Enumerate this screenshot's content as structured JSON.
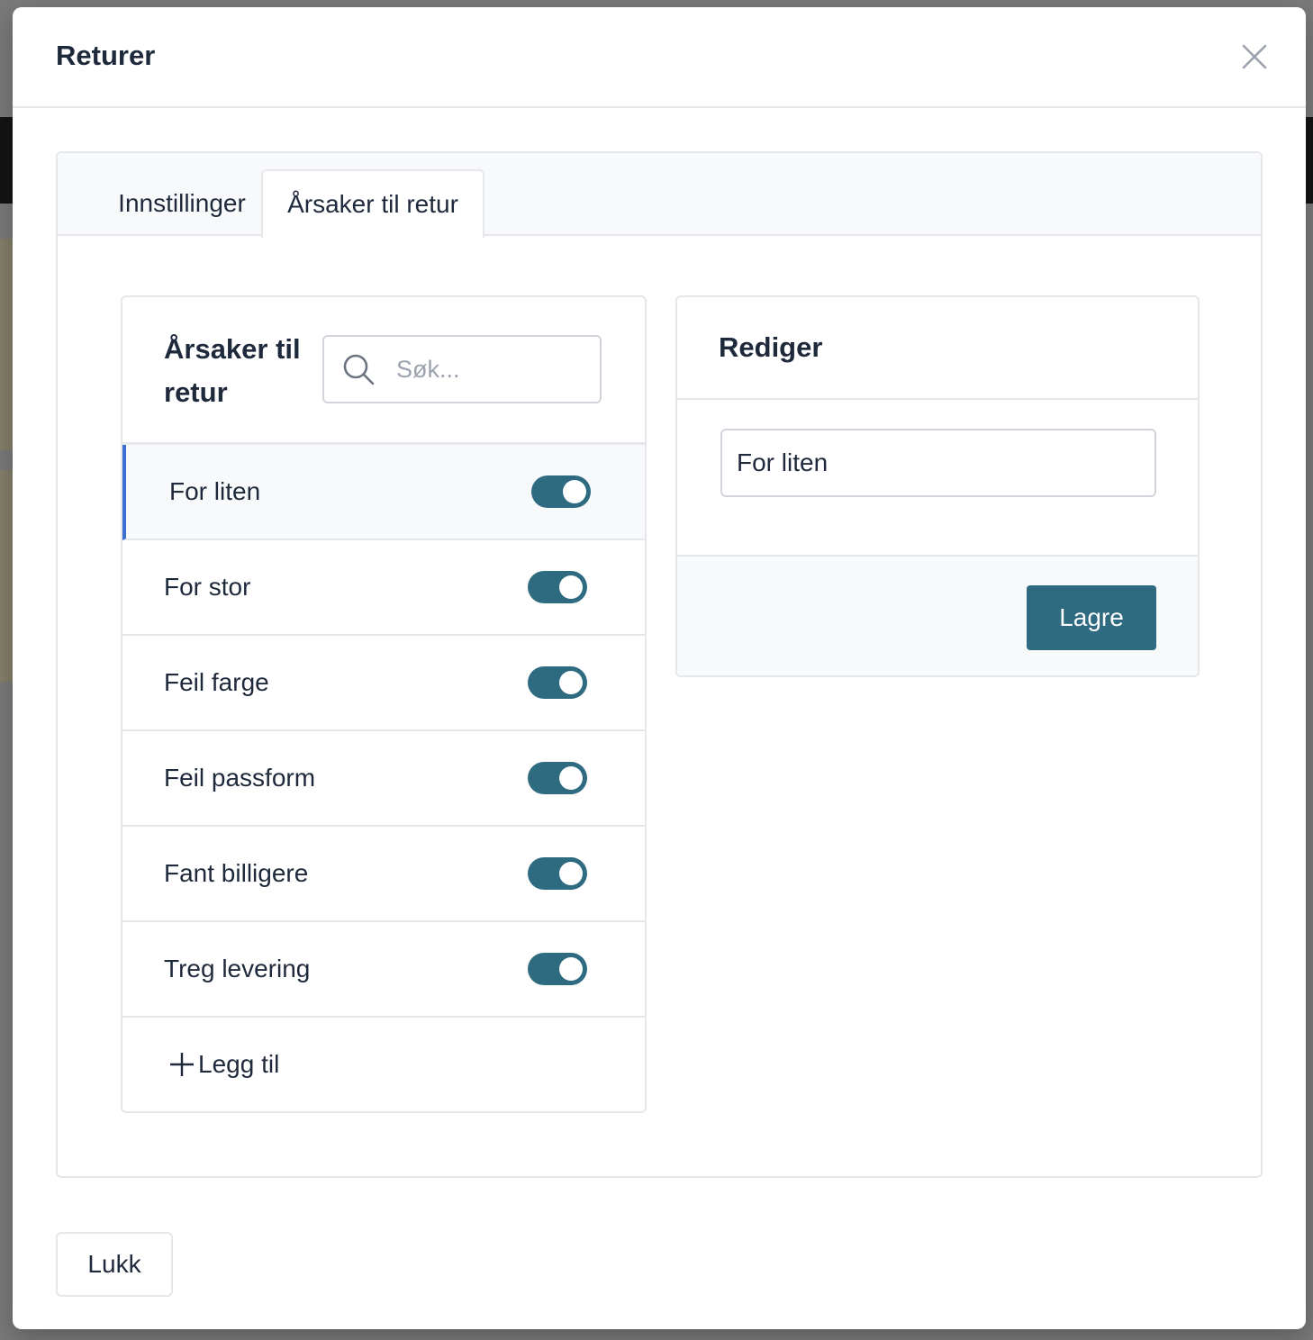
{
  "modal": {
    "title": "Returer",
    "close_icon": "close-icon"
  },
  "tabs": [
    {
      "label": "Innstillinger",
      "active": false
    },
    {
      "label": "Årsaker til retur",
      "active": true
    }
  ],
  "reasons_panel": {
    "title": "Årsaker til retur",
    "search": {
      "placeholder": "Søk...",
      "value": ""
    },
    "items": [
      {
        "label": "For liten",
        "enabled": true,
        "selected": true
      },
      {
        "label": "For stor",
        "enabled": true,
        "selected": false
      },
      {
        "label": "Feil farge",
        "enabled": true,
        "selected": false
      },
      {
        "label": "Feil passform",
        "enabled": true,
        "selected": false
      },
      {
        "label": "Fant billigere",
        "enabled": true,
        "selected": false
      },
      {
        "label": "Treg levering",
        "enabled": true,
        "selected": false
      }
    ],
    "add_label": "Legg til"
  },
  "edit_panel": {
    "title": "Rediger",
    "input_value": "For liten",
    "save_label": "Lagre"
  },
  "footer": {
    "close_label": "Lukk"
  },
  "colors": {
    "accent": "#2e6a80",
    "selected_border": "#3b6fd1",
    "border": "#e5e7eb"
  }
}
